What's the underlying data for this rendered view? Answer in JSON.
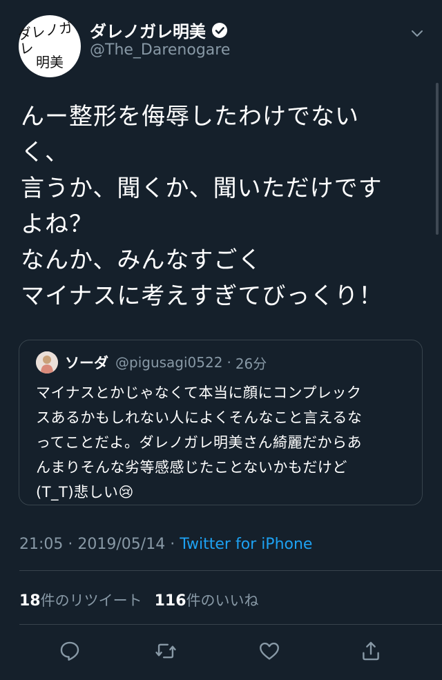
{
  "author": {
    "avatar_text_line1": "ダレノガレ",
    "avatar_text_line2": "明美",
    "name": "ダレノガレ明美",
    "handle": "@The_Darenogare",
    "verified": true
  },
  "tweet": {
    "lines": [
      "んー整形を侮辱したわけでない",
      "く、",
      "言うか、聞くか、聞いただけです",
      "よね？",
      "なんか、みんなすごく",
      "マイナスに考えすぎてびっくり！"
    ]
  },
  "quote": {
    "name": "ソーダ",
    "handle": "@pigusagi0522",
    "separator": "·",
    "time": "26分",
    "lines": [
      "マイナスとかじゃなくて本当に顔にコンプレック",
      "スあるかもしれない人によくそんなこと言えるな",
      "ってことだよ。ダレノガレ明美さん綺麗だからあ",
      "んまりそんな劣等感感じたことないかもだけど",
      "(T_T)悲しい😢"
    ]
  },
  "meta": {
    "time": "21:05",
    "sep1": "·",
    "date": "2019/05/14",
    "sep2": "·",
    "source": "Twitter for iPhone"
  },
  "stats": {
    "retweets_count": "18",
    "retweets_label": "件のリツイート",
    "likes_count": "116",
    "likes_label": "件のいいね"
  },
  "actions": {
    "reply_icon": "reply-icon",
    "retweet_icon": "retweet-icon",
    "like_icon": "heart-icon",
    "share_icon": "share-icon"
  },
  "colors": {
    "background": "#15202b",
    "secondary_text": "#8899a6",
    "link": "#1da1f2",
    "border": "#38444d"
  }
}
